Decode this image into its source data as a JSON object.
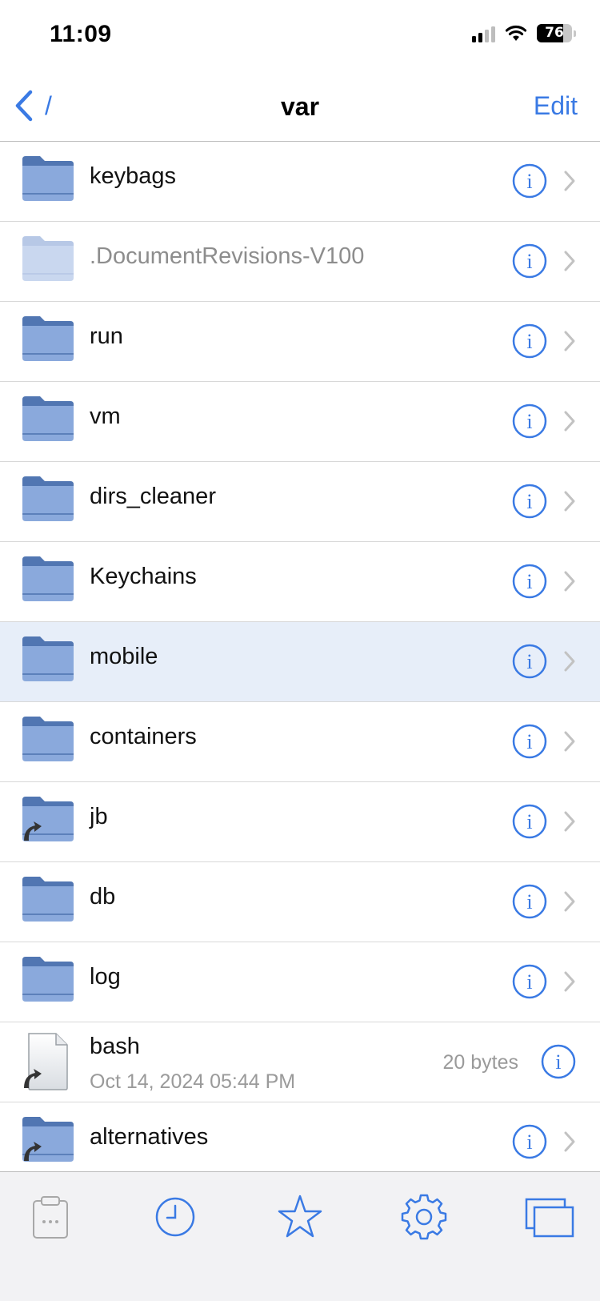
{
  "status": {
    "time": "11:09",
    "battery": "76",
    "battery_level_percent": 76
  },
  "nav": {
    "back_label": "/",
    "title": "var",
    "edit_label": "Edit"
  },
  "colors": {
    "accent": "#3a7ae4",
    "folder": "#8aa9dc",
    "folder_tab": "#5176b2",
    "selected_row": "#e7eef9"
  },
  "items": [
    {
      "name": "keybags",
      "kind": "folder"
    },
    {
      "name": ".DocumentRevisions-V100",
      "kind": "folder-hidden"
    },
    {
      "name": "run",
      "kind": "folder"
    },
    {
      "name": "vm",
      "kind": "folder"
    },
    {
      "name": "dirs_cleaner",
      "kind": "folder"
    },
    {
      "name": "Keychains",
      "kind": "folder"
    },
    {
      "name": "mobile",
      "kind": "folder",
      "selected": true
    },
    {
      "name": "containers",
      "kind": "folder"
    },
    {
      "name": "jb",
      "kind": "folder-symlink"
    },
    {
      "name": "db",
      "kind": "folder"
    },
    {
      "name": "log",
      "kind": "folder"
    },
    {
      "name": "bash",
      "kind": "file-symlink",
      "date": "Oct 14, 2024 05:44 PM",
      "size": "20 bytes"
    },
    {
      "name": "alternatives",
      "kind": "folder-symlink"
    }
  ],
  "tabbar": [
    {
      "icon": "clipboard-icon"
    },
    {
      "icon": "clock-icon"
    },
    {
      "icon": "star-icon"
    },
    {
      "icon": "gear-icon"
    },
    {
      "icon": "windows-icon"
    }
  ]
}
